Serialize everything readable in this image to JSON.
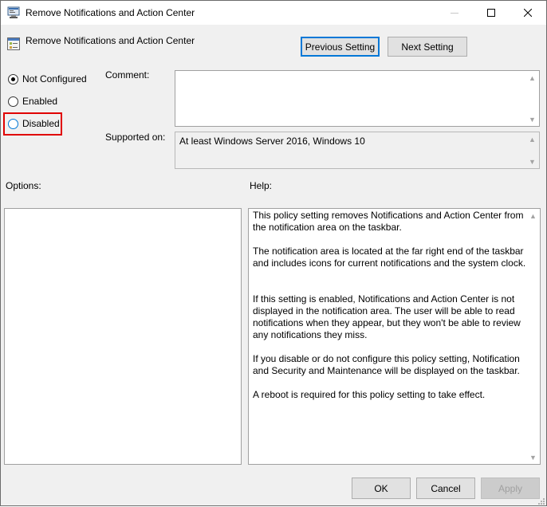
{
  "window": {
    "title": "Remove Notifications and Action Center",
    "icon": "policy-editor-icon"
  },
  "header": {
    "policy_name": "Remove Notifications and Action Center",
    "prev_label": "Previous Setting",
    "next_label": "Next Setting"
  },
  "state": {
    "options": [
      {
        "label": "Not Configured",
        "checked": true
      },
      {
        "label": "Enabled",
        "checked": false
      },
      {
        "label": "Disabled",
        "checked": false,
        "highlighted": true
      }
    ]
  },
  "comment": {
    "label": "Comment:",
    "value": ""
  },
  "supported": {
    "label": "Supported on:",
    "value": "At least Windows Server 2016, Windows 10"
  },
  "options_panel": {
    "label": "Options:"
  },
  "help": {
    "label": "Help:",
    "paragraphs": [
      "This policy setting removes Notifications and Action Center from the notification area on the taskbar.",
      "The notification area is located at the far right end of the taskbar and includes icons for current notifications and the system clock.",
      "If this setting is enabled, Notifications and Action Center is not displayed in the notification area. The user will be able to read notifications when they appear, but they won't be able to review any notifications they miss.",
      "If you disable or do not configure this policy setting, Notification and Security and Maintenance will be displayed on the taskbar.",
      "A reboot is required for this policy setting to take effect."
    ]
  },
  "footer": {
    "ok_label": "OK",
    "cancel_label": "Cancel",
    "apply_label": "Apply"
  },
  "colors": {
    "highlight": "#e00000",
    "focus": "#0078d7"
  }
}
